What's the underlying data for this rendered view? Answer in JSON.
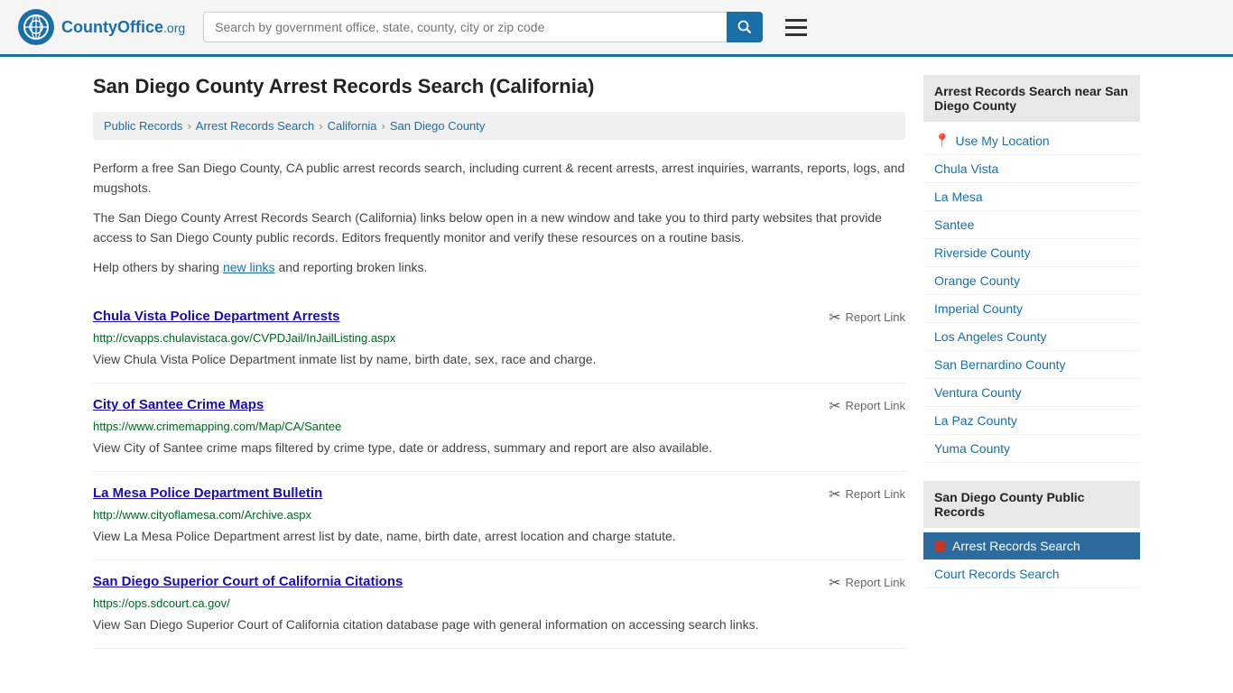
{
  "header": {
    "logo_text": "CountyOffice",
    "logo_org": ".org",
    "search_placeholder": "Search by government office, state, county, city or zip code"
  },
  "page": {
    "title": "San Diego County Arrest Records Search (California)"
  },
  "breadcrumb": {
    "items": [
      {
        "label": "Public Records",
        "href": "#"
      },
      {
        "label": "Arrest Records Search",
        "href": "#"
      },
      {
        "label": "California",
        "href": "#"
      },
      {
        "label": "San Diego County",
        "href": "#"
      }
    ]
  },
  "description": {
    "p1": "Perform a free San Diego County, CA public arrest records search, including current & recent arrests, arrest inquiries, warrants, reports, logs, and mugshots.",
    "p2": "The San Diego County Arrest Records Search (California) links below open in a new window and take you to third party websites that provide access to San Diego County public records. Editors frequently monitor and verify these resources on a routine basis.",
    "p3_before": "Help others by sharing ",
    "p3_link": "new links",
    "p3_after": " and reporting broken links."
  },
  "results": [
    {
      "title": "Chula Vista Police Department Arrests",
      "url": "http://cvapps.chulavistaca.gov/CVPDJail/InJailListing.aspx",
      "desc": "View Chula Vista Police Department inmate list by name, birth date, sex, race and charge.",
      "report_label": "Report Link"
    },
    {
      "title": "City of Santee Crime Maps",
      "url": "https://www.crimemapping.com/Map/CA/Santee",
      "desc": "View City of Santee crime maps filtered by crime type, date or address, summary and report are also available.",
      "report_label": "Report Link"
    },
    {
      "title": "La Mesa Police Department Bulletin",
      "url": "http://www.cityoflamesa.com/Archive.aspx",
      "desc": "View La Mesa Police Department arrest list by date, name, birth date, arrest location and charge statute.",
      "report_label": "Report Link"
    },
    {
      "title": "San Diego Superior Court of California Citations",
      "url": "https://ops.sdcourt.ca.gov/",
      "desc": "View San Diego Superior Court of California citation database page with general information on accessing search links.",
      "report_label": "Report Link"
    }
  ],
  "sidebar": {
    "nearby_header": "Arrest Records Search near San Diego County",
    "use_my_location": "Use My Location",
    "nearby_links": [
      "Chula Vista",
      "La Mesa",
      "Santee",
      "Riverside County",
      "Orange County",
      "Imperial County",
      "Los Angeles County",
      "San Bernardino County",
      "Ventura County",
      "La Paz County",
      "Yuma County"
    ],
    "public_records_header": "San Diego County Public Records",
    "public_records_links": [
      {
        "label": "Arrest Records Search",
        "active": true
      },
      {
        "label": "Court Records Search",
        "active": false
      }
    ]
  }
}
